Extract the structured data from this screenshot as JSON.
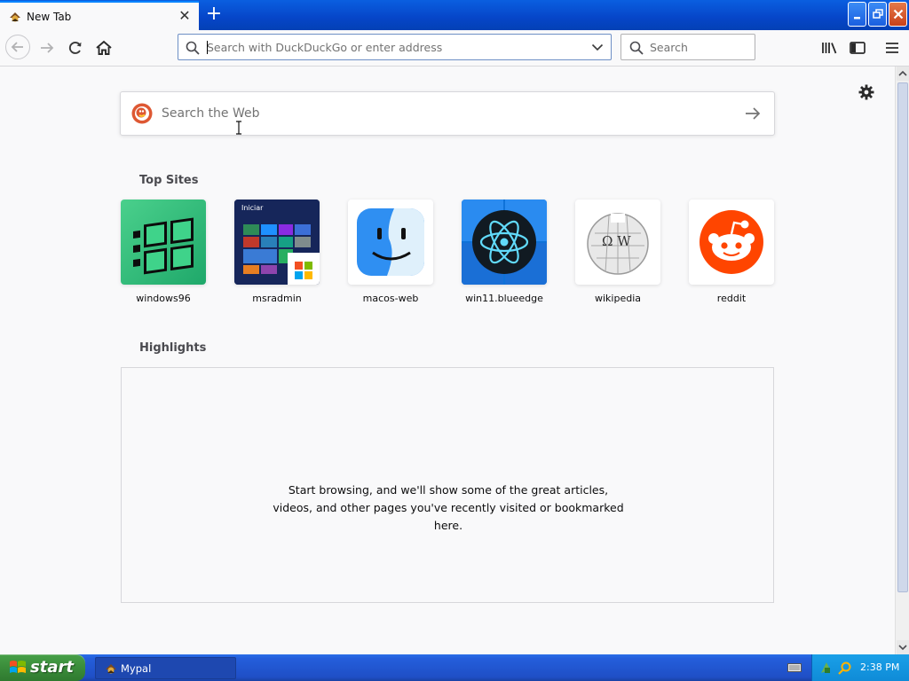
{
  "browser": {
    "tab": {
      "title": "New Tab",
      "close_glyph": "✕"
    },
    "new_tab_glyph": "+",
    "urlbar": {
      "placeholder": "Search with DuckDuckGo or enter address"
    },
    "searchbar": {
      "placeholder": "Search"
    }
  },
  "newtab": {
    "web_search": {
      "placeholder": "Search the Web"
    },
    "top_sites_title": "Top Sites",
    "top_sites": [
      {
        "label": "windows96",
        "icon": "windows96-logo"
      },
      {
        "label": "msradmin",
        "icon": "windows8-start-screen",
        "tile_text": "Iniciar"
      },
      {
        "label": "macos-web",
        "icon": "finder-face"
      },
      {
        "label": "win11.blueedge",
        "icon": "react-atom"
      },
      {
        "label": "wikipedia",
        "icon": "wikipedia-globe",
        "tile_text": "Ω W"
      },
      {
        "label": "reddit",
        "icon": "reddit-alien"
      }
    ],
    "highlights_title": "Highlights",
    "highlights_empty_message": "Start browsing, and we'll show some of the great articles, videos, and other pages you've recently visited or bookmarked here."
  },
  "taskbar": {
    "start_label": "start",
    "task_label": "Mypal",
    "clock": "2:38 PM"
  },
  "colors": {
    "titlebar_blue": "#0645c8",
    "accent_blue": "#0a84ff",
    "start_green": "#3a8c3a",
    "reddit_orange": "#ff4500",
    "tray_blue": "#0f8bd7"
  }
}
